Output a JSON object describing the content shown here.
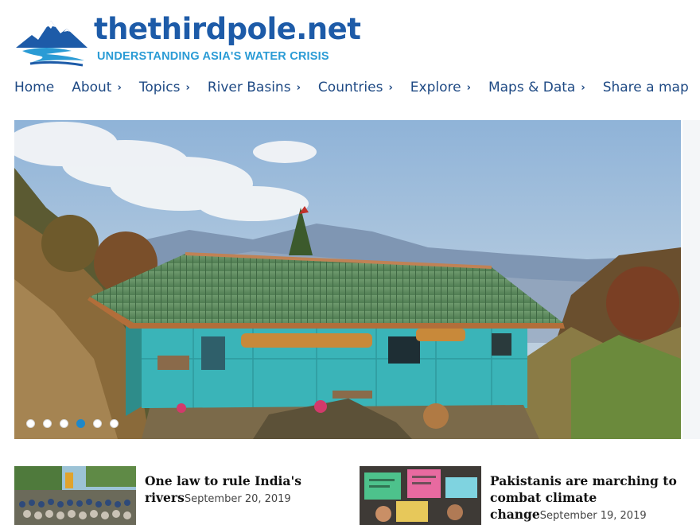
{
  "site": {
    "name": "thethirdpole.net",
    "tagline": "UNDERSTANDING ASIA'S WATER CRISIS",
    "brand_color": "#1d5ba8",
    "tagline_color": "#2a9bd5"
  },
  "nav": {
    "items": [
      {
        "label": "Home",
        "has_chevron": false
      },
      {
        "label": "About",
        "has_chevron": true
      },
      {
        "label": "Topics",
        "has_chevron": true
      },
      {
        "label": "River Basins",
        "has_chevron": true
      },
      {
        "label": "Countries",
        "has_chevron": true
      },
      {
        "label": "Explore",
        "has_chevron": true
      },
      {
        "label": "Maps & Data",
        "has_chevron": true
      },
      {
        "label": "Share a map",
        "has_chevron": false
      }
    ],
    "chevron_glyph": "›"
  },
  "hero": {
    "slide_count": 6,
    "active_slide": 4,
    "dot_active_color": "#1f88c9"
  },
  "articles": [
    {
      "title": "One law to rule India's rivers",
      "date": "September 20, 2019"
    },
    {
      "title": "Pakistanis are marching to combat climate change",
      "date": "September 19, 2019"
    }
  ]
}
